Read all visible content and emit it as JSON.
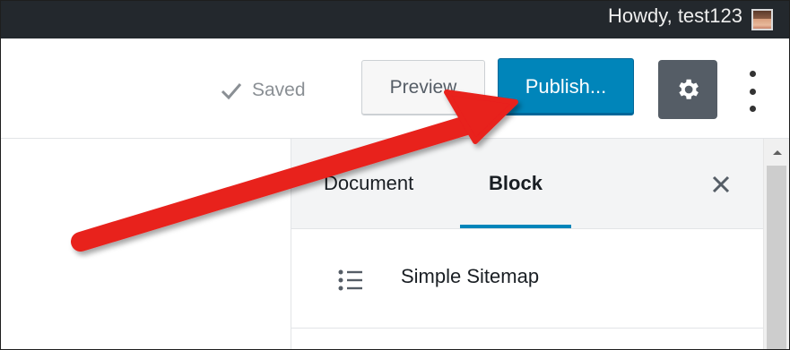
{
  "admin_bar": {
    "greeting": "Howdy, test123",
    "avatar_icon": "user-avatar"
  },
  "header": {
    "saved_label": "Saved",
    "saved_icon": "check-icon",
    "preview_label": "Preview",
    "publish_label": "Publish...",
    "settings_icon": "gear-icon",
    "more_icon": "vertical-ellipsis-icon"
  },
  "sidebar": {
    "tabs": [
      {
        "label": "Document",
        "active": false
      },
      {
        "label": "Block",
        "active": true
      }
    ],
    "close_icon": "close-icon",
    "block": {
      "icon": "list-icon",
      "title": "Simple Sitemap"
    }
  },
  "colors": {
    "admin_bar": "#23282d",
    "publish": "#0085ba",
    "settings": "#555d66",
    "annotation_arrow": "#e8201d"
  }
}
